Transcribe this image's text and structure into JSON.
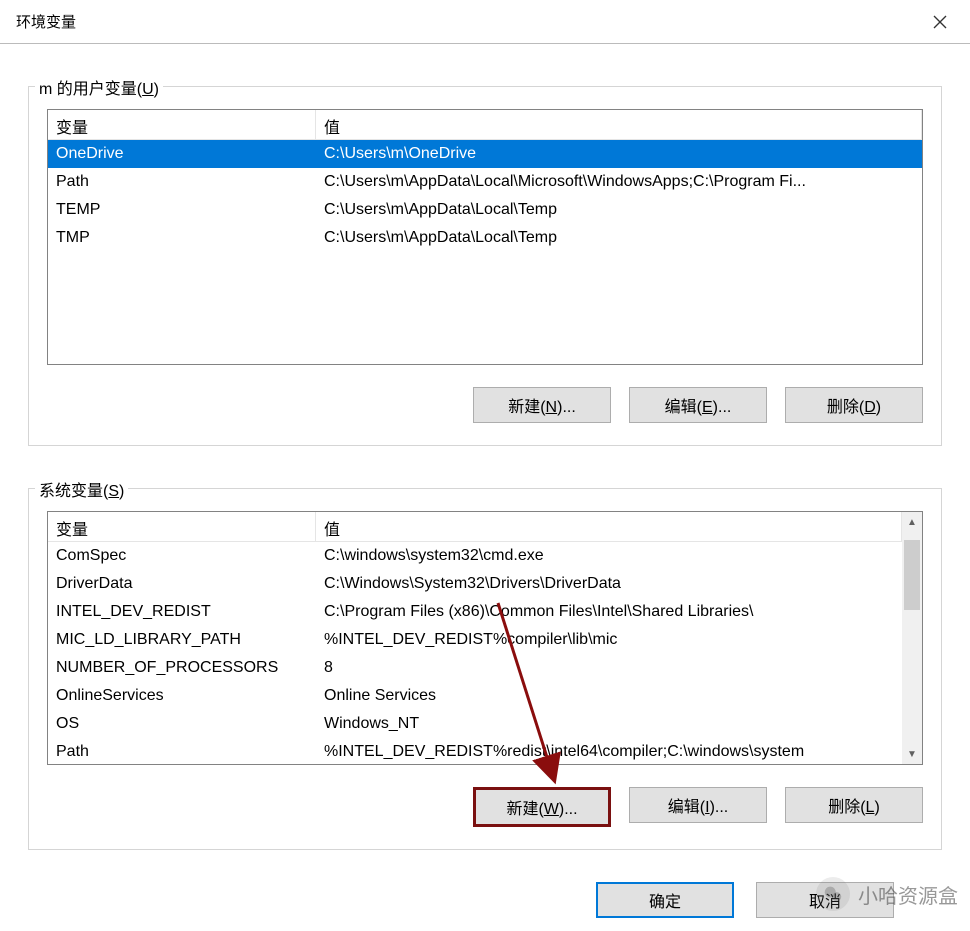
{
  "title": "环境变量",
  "user_section": {
    "label_pre": "m 的用户变量(",
    "label_u": "U",
    "label_post": ")",
    "headers": {
      "var": "变量",
      "val": "值"
    },
    "rows": [
      {
        "var": "OneDrive",
        "val": "C:\\Users\\m\\OneDrive",
        "selected": true
      },
      {
        "var": "Path",
        "val": "C:\\Users\\m\\AppData\\Local\\Microsoft\\WindowsApps;C:\\Program Fi...",
        "selected": false
      },
      {
        "var": "TEMP",
        "val": "C:\\Users\\m\\AppData\\Local\\Temp",
        "selected": false
      },
      {
        "var": "TMP",
        "val": "C:\\Users\\m\\AppData\\Local\\Temp",
        "selected": false
      }
    ],
    "buttons": {
      "new": {
        "pre": "新建(",
        "u": "N",
        "post": ")..."
      },
      "edit": {
        "pre": "编辑(",
        "u": "E",
        "post": ")..."
      },
      "delete": {
        "pre": "删除(",
        "u": "D",
        "post": ")"
      }
    }
  },
  "sys_section": {
    "label_pre": "系统变量(",
    "label_u": "S",
    "label_post": ")",
    "headers": {
      "var": "变量",
      "val": "值"
    },
    "rows": [
      {
        "var": "ComSpec",
        "val": "C:\\windows\\system32\\cmd.exe"
      },
      {
        "var": "DriverData",
        "val": "C:\\Windows\\System32\\Drivers\\DriverData"
      },
      {
        "var": "INTEL_DEV_REDIST",
        "val": "C:\\Program Files (x86)\\Common Files\\Intel\\Shared Libraries\\"
      },
      {
        "var": "MIC_LD_LIBRARY_PATH",
        "val": "%INTEL_DEV_REDIST%compiler\\lib\\mic"
      },
      {
        "var": "NUMBER_OF_PROCESSORS",
        "val": "8"
      },
      {
        "var": "OnlineServices",
        "val": "Online Services"
      },
      {
        "var": "OS",
        "val": "Windows_NT"
      },
      {
        "var": "Path",
        "val": "%INTEL_DEV_REDIST%redist\\intel64\\compiler;C:\\windows\\system"
      }
    ],
    "buttons": {
      "new": {
        "pre": "新建(",
        "u": "W",
        "post": ")..."
      },
      "edit": {
        "pre": "编辑(",
        "u": "I",
        "post": ")..."
      },
      "delete": {
        "pre": "删除(",
        "u": "L",
        "post": ")"
      }
    }
  },
  "footer": {
    "ok": "确定",
    "cancel": "取消"
  },
  "watermark": "小哈资源盒"
}
